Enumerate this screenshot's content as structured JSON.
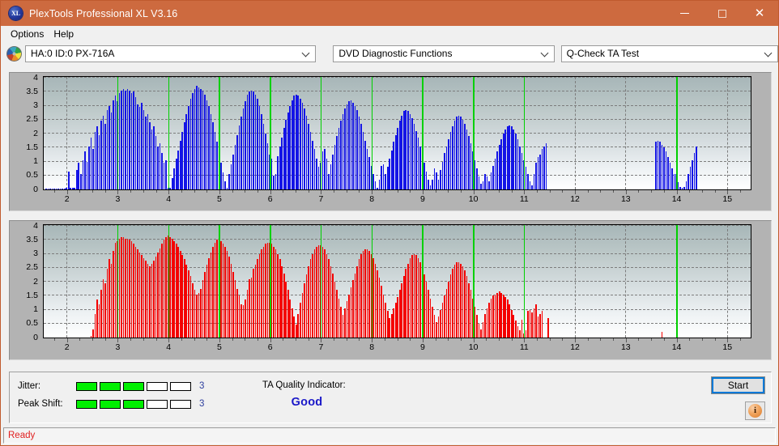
{
  "window": {
    "title": "PlexTools Professional XL V3.16",
    "icon": "xl-app-icon",
    "minimize_label": "–",
    "maximize_label": "□",
    "close_label": "×"
  },
  "menu": {
    "items": [
      {
        "label": "Options"
      },
      {
        "label": "Help"
      }
    ]
  },
  "toolbar": {
    "drive_icon": "disc-icon",
    "drive": "HA:0 ID:0  PX-716A",
    "function_group": "DVD Diagnostic Functions",
    "test": "Q-Check TA Test"
  },
  "info_panel": {
    "jitter_label": "Jitter:",
    "jitter_value": "3",
    "jitter_filled": 3,
    "jitter_total": 5,
    "peak_shift_label": "Peak Shift:",
    "peak_shift_value": "3",
    "peak_shift_filled": 3,
    "peak_shift_total": 5,
    "ta_quality_label": "TA Quality Indicator:",
    "ta_quality_value": "Good",
    "ta_quality_color": "#1a18c8",
    "start_label": "Start",
    "info_icon": "info-icon",
    "meter_on_color": "#00f000"
  },
  "status_bar": {
    "text": "Ready",
    "color": "#e02020"
  },
  "chart_data": [
    {
      "id": "jitter-chart",
      "type": "bar",
      "title": "",
      "xlabel": "",
      "ylabel": "",
      "series_name": "Jitter",
      "color": "#1414e6",
      "marker_color": "#00d000",
      "grid": true,
      "xlim": [
        1.55,
        15.45
      ],
      "ylim": [
        0,
        4
      ],
      "ytick_labels": [
        "4",
        "3.5",
        "3",
        "2.5",
        "2",
        "1.5",
        "1",
        "0.5",
        "0"
      ],
      "yticks": [
        4,
        3.5,
        3,
        2.5,
        2,
        1.5,
        1,
        0.5,
        0
      ],
      "xtick_labels": [
        "2",
        "3",
        "4",
        "5",
        "6",
        "7",
        "8",
        "9",
        "10",
        "11",
        "12",
        "13",
        "14",
        "15"
      ],
      "xticks": [
        2,
        3,
        4,
        5,
        6,
        7,
        8,
        9,
        10,
        11,
        12,
        13,
        14,
        15
      ],
      "markers": [
        3,
        4,
        5,
        6,
        7,
        8,
        9,
        10,
        11,
        14
      ],
      "x": [
        1.6,
        1.64,
        1.68,
        1.72,
        1.76,
        1.8,
        1.84,
        1.88,
        1.92,
        1.96,
        2.0,
        2.04,
        2.08,
        2.12,
        2.16,
        2.2,
        2.24,
        2.28,
        2.32,
        2.36,
        2.4,
        2.44,
        2.48,
        2.52,
        2.56,
        2.6,
        2.64,
        2.68,
        2.72,
        2.76,
        2.8,
        2.84,
        2.88,
        2.92,
        2.96,
        3.0,
        3.04,
        3.08,
        3.12,
        3.16,
        3.2,
        3.24,
        3.28,
        3.32,
        3.36,
        3.4,
        3.44,
        3.48,
        3.52,
        3.56,
        3.6,
        3.64,
        3.68,
        3.72,
        3.76,
        3.8,
        3.84,
        3.88,
        3.92,
        3.96,
        4.0,
        4.04,
        4.08,
        4.12,
        4.16,
        4.2,
        4.24,
        4.28,
        4.32,
        4.36,
        4.4,
        4.44,
        4.48,
        4.52,
        4.56,
        4.6,
        4.64,
        4.68,
        4.72,
        4.76,
        4.8,
        4.84,
        4.88,
        4.92,
        4.96,
        5.0,
        5.04,
        5.08,
        5.12,
        5.16,
        5.2,
        5.24,
        5.28,
        5.32,
        5.36,
        5.4,
        5.44,
        5.48,
        5.52,
        5.56,
        5.6,
        5.64,
        5.68,
        5.72,
        5.76,
        5.8,
        5.84,
        5.88,
        5.92,
        5.96,
        6.0,
        6.04,
        6.08,
        6.12,
        6.16,
        6.2,
        6.24,
        6.28,
        6.32,
        6.36,
        6.4,
        6.44,
        6.48,
        6.52,
        6.56,
        6.6,
        6.64,
        6.68,
        6.72,
        6.76,
        6.8,
        6.84,
        6.88,
        6.92,
        6.96,
        7.0,
        7.04,
        7.08,
        7.12,
        7.16,
        7.2,
        7.24,
        7.28,
        7.32,
        7.36,
        7.4,
        7.44,
        7.48,
        7.52,
        7.56,
        7.6,
        7.64,
        7.68,
        7.72,
        7.76,
        7.8,
        7.84,
        7.88,
        7.92,
        7.96,
        8.0,
        8.04,
        8.08,
        8.12,
        8.16,
        8.2,
        8.24,
        8.28,
        8.32,
        8.36,
        8.4,
        8.44,
        8.48,
        8.52,
        8.56,
        8.6,
        8.64,
        8.68,
        8.72,
        8.76,
        8.8,
        8.84,
        8.88,
        8.92,
        8.96,
        9.0,
        9.04,
        9.08,
        9.12,
        9.16,
        9.2,
        9.24,
        9.28,
        9.32,
        9.36,
        9.4,
        9.44,
        9.48,
        9.52,
        9.56,
        9.6,
        9.64,
        9.68,
        9.72,
        9.76,
        9.8,
        9.84,
        9.88,
        9.92,
        9.96,
        10.0,
        10.04,
        10.08,
        10.12,
        10.16,
        10.2,
        10.24,
        10.28,
        10.32,
        10.36,
        10.4,
        10.44,
        10.48,
        10.52,
        10.56,
        10.6,
        10.64,
        10.68,
        10.72,
        10.76,
        10.8,
        10.84,
        10.88,
        10.92,
        10.96,
        11.0,
        11.04,
        11.08,
        11.12,
        11.16,
        11.2,
        11.24,
        11.28,
        11.32,
        11.36,
        11.4,
        11.44,
        13.6,
        13.64,
        13.68,
        13.72,
        13.76,
        13.8,
        13.84,
        13.88,
        13.92,
        13.96,
        14.0,
        14.04,
        14.08,
        14.12,
        14.16,
        14.2,
        14.24,
        14.28,
        14.32,
        14.36,
        14.4
      ],
      "values": [
        0.04,
        0.04,
        0.04,
        0.04,
        0.04,
        0.04,
        0.04,
        0.04,
        0.04,
        0.04,
        0.05,
        0.65,
        0.05,
        0.05,
        0.05,
        0.7,
        0.95,
        0.55,
        1.05,
        1.35,
        1.0,
        1.55,
        1.85,
        1.45,
        2.05,
        2.25,
        1.95,
        2.45,
        2.65,
        2.35,
        2.85,
        3.0,
        2.75,
        3.2,
        3.35,
        3.15,
        3.45,
        3.55,
        3.6,
        3.55,
        3.6,
        3.55,
        3.45,
        3.5,
        3.3,
        3.05,
        2.95,
        3.1,
        2.85,
        2.6,
        2.7,
        2.4,
        2.15,
        2.25,
        1.9,
        1.55,
        1.65,
        1.3,
        0.95,
        1.05,
        0.05,
        0.05,
        0.4,
        0.75,
        1.1,
        1.4,
        1.75,
        2.05,
        2.4,
        2.7,
        3.0,
        3.25,
        3.45,
        3.6,
        3.7,
        3.65,
        3.6,
        3.55,
        3.4,
        3.2,
        3.0,
        2.7,
        2.4,
        2.05,
        1.7,
        1.3,
        0.95,
        0.6,
        0.3,
        0.05,
        0.55,
        0.9,
        1.25,
        1.6,
        1.95,
        2.3,
        2.6,
        2.9,
        3.15,
        3.4,
        3.5,
        3.55,
        3.5,
        3.4,
        3.25,
        3.0,
        2.7,
        2.35,
        2.0,
        1.65,
        1.25,
        1.1,
        0.5,
        0.55,
        1.2,
        1.55,
        1.85,
        2.2,
        2.5,
        2.75,
        3.0,
        3.2,
        3.35,
        3.4,
        3.35,
        3.25,
        3.1,
        2.9,
        2.65,
        2.35,
        2.05,
        1.75,
        1.45,
        1.1,
        0.8,
        0.95,
        1.35,
        1.45,
        1.1,
        0.55,
        0.9,
        1.25,
        1.6,
        1.9,
        2.2,
        2.45,
        2.7,
        2.9,
        3.05,
        3.15,
        3.2,
        3.1,
        3.0,
        2.85,
        2.6,
        2.35,
        2.05,
        1.75,
        1.45,
        1.15,
        0.85,
        0.55,
        0.3,
        0.05,
        0.35,
        0.85,
        0.9,
        0.55,
        0.8,
        1.1,
        1.4,
        1.7,
        1.95,
        2.2,
        2.45,
        2.65,
        2.8,
        2.85,
        2.8,
        2.7,
        2.55,
        2.35,
        2.1,
        1.85,
        1.55,
        1.25,
        0.95,
        0.65,
        0.35,
        0.15,
        0.35,
        0.75,
        0.6,
        0.35,
        0.7,
        1.0,
        1.3,
        1.55,
        1.8,
        2.05,
        2.25,
        2.45,
        2.6,
        2.65,
        2.6,
        2.5,
        2.35,
        2.15,
        1.9,
        1.65,
        1.35,
        1.05,
        0.75,
        0.45,
        0.2,
        0.3,
        0.55,
        0.45,
        0.3,
        0.6,
        0.85,
        1.1,
        1.35,
        1.6,
        1.8,
        2.0,
        2.15,
        2.25,
        2.3,
        2.25,
        2.15,
        2.0,
        1.8,
        1.55,
        1.3,
        1.05,
        0.8,
        0.55,
        0.3,
        0.15,
        0.55,
        0.95,
        1.15,
        1.25,
        1.45,
        1.55,
        1.65,
        1.7,
        1.75,
        1.7,
        1.6,
        1.5,
        1.35,
        1.15,
        0.95,
        0.75,
        0.55,
        0.55,
        0.25,
        0.1,
        0.05,
        0.1,
        0.3,
        0.55,
        0.8,
        1.05,
        1.3,
        1.55,
        1.75,
        1.95,
        2.1,
        2.15,
        2.2,
        2.15,
        2.05,
        1.9,
        1.7,
        1.45,
        1.15,
        0.85,
        0.5,
        0.2
      ]
    },
    {
      "id": "peak-shift-chart",
      "type": "bar",
      "title": "",
      "xlabel": "",
      "ylabel": "",
      "series_name": "Peak Shift",
      "color": "#f40000",
      "marker_color": "#00d000",
      "grid": true,
      "xlim": [
        1.55,
        15.45
      ],
      "ylim": [
        0,
        4
      ],
      "ytick_labels": [
        "4",
        "3.5",
        "3",
        "2.5",
        "2",
        "1.5",
        "1",
        "0.5",
        "0"
      ],
      "yticks": [
        4,
        3.5,
        3,
        2.5,
        2,
        1.5,
        1,
        0.5,
        0
      ],
      "xtick_labels": [
        "2",
        "3",
        "4",
        "5",
        "6",
        "7",
        "8",
        "9",
        "10",
        "11",
        "12",
        "13",
        "14",
        "15"
      ],
      "xticks": [
        2,
        3,
        4,
        5,
        6,
        7,
        8,
        9,
        10,
        11,
        12,
        13,
        14,
        15
      ],
      "markers": [
        3,
        4,
        5,
        6,
        7,
        8,
        9,
        10,
        11,
        14
      ],
      "x": [
        2.48,
        2.52,
        2.56,
        2.6,
        2.64,
        2.68,
        2.72,
        2.76,
        2.8,
        2.84,
        2.88,
        2.92,
        2.96,
        3.0,
        3.04,
        3.08,
        3.12,
        3.16,
        3.2,
        3.24,
        3.28,
        3.32,
        3.36,
        3.4,
        3.44,
        3.48,
        3.52,
        3.56,
        3.6,
        3.64,
        3.68,
        3.72,
        3.76,
        3.8,
        3.84,
        3.88,
        3.92,
        3.96,
        4.0,
        4.04,
        4.08,
        4.12,
        4.16,
        4.2,
        4.24,
        4.28,
        4.32,
        4.36,
        4.4,
        4.44,
        4.48,
        4.52,
        4.56,
        4.6,
        4.64,
        4.68,
        4.72,
        4.76,
        4.8,
        4.84,
        4.88,
        4.92,
        4.96,
        5.0,
        5.04,
        5.08,
        5.12,
        5.16,
        5.2,
        5.24,
        5.28,
        5.32,
        5.36,
        5.4,
        5.44,
        5.48,
        5.52,
        5.56,
        5.6,
        5.64,
        5.68,
        5.72,
        5.76,
        5.8,
        5.84,
        5.88,
        5.92,
        5.96,
        6.0,
        6.04,
        6.08,
        6.12,
        6.16,
        6.2,
        6.24,
        6.28,
        6.32,
        6.36,
        6.4,
        6.44,
        6.48,
        6.52,
        6.56,
        6.6,
        6.64,
        6.68,
        6.72,
        6.76,
        6.8,
        6.84,
        6.88,
        6.92,
        6.96,
        7.0,
        7.04,
        7.08,
        7.12,
        7.16,
        7.2,
        7.24,
        7.28,
        7.32,
        7.36,
        7.4,
        7.44,
        7.48,
        7.52,
        7.56,
        7.6,
        7.64,
        7.68,
        7.72,
        7.76,
        7.8,
        7.84,
        7.88,
        7.92,
        7.96,
        8.0,
        8.04,
        8.08,
        8.12,
        8.16,
        8.2,
        8.24,
        8.28,
        8.32,
        8.36,
        8.4,
        8.44,
        8.48,
        8.52,
        8.56,
        8.6,
        8.64,
        8.68,
        8.72,
        8.76,
        8.8,
        8.84,
        8.88,
        8.92,
        8.96,
        9.0,
        9.04,
        9.08,
        9.12,
        9.16,
        9.2,
        9.24,
        9.28,
        9.32,
        9.36,
        9.4,
        9.44,
        9.48,
        9.52,
        9.56,
        9.6,
        9.64,
        9.68,
        9.72,
        9.76,
        9.8,
        9.84,
        9.88,
        9.92,
        9.96,
        10.0,
        10.04,
        10.08,
        10.12,
        10.16,
        10.2,
        10.24,
        10.28,
        10.32,
        10.36,
        10.4,
        10.44,
        10.48,
        10.52,
        10.56,
        10.6,
        10.64,
        10.68,
        10.72,
        10.76,
        10.8,
        10.84,
        10.88,
        10.92,
        10.96,
        11.0,
        11.04,
        11.08,
        11.12,
        11.16,
        11.2,
        11.24,
        11.28,
        11.32,
        11.36,
        11.48,
        13.72,
        13.8,
        13.84,
        13.88,
        13.92,
        13.96,
        14.0,
        14.04,
        14.08,
        14.12,
        14.16
      ],
      "values": [
        0.05,
        0.3,
        0.85,
        1.35,
        1.2,
        1.7,
        2.1,
        1.95,
        2.45,
        2.8,
        2.65,
        3.1,
        3.4,
        3.45,
        3.55,
        3.6,
        3.6,
        3.55,
        3.55,
        3.5,
        3.45,
        3.35,
        3.25,
        3.15,
        3.05,
        2.95,
        2.85,
        2.75,
        2.65,
        2.55,
        2.65,
        2.75,
        2.9,
        3.05,
        3.2,
        3.35,
        3.5,
        3.6,
        3.65,
        3.6,
        3.55,
        3.45,
        3.35,
        3.25,
        3.1,
        2.95,
        2.8,
        2.6,
        2.4,
        2.2,
        1.95,
        1.7,
        1.55,
        1.6,
        1.75,
        2.05,
        2.35,
        2.6,
        2.85,
        3.05,
        3.25,
        3.4,
        3.5,
        3.5,
        3.45,
        3.35,
        3.25,
        3.1,
        2.9,
        2.65,
        2.35,
        2.05,
        1.75,
        1.5,
        1.2,
        1.15,
        1.35,
        1.7,
        2.1,
        2.15,
        2.45,
        2.6,
        2.8,
        3.0,
        3.15,
        3.25,
        3.35,
        3.4,
        3.4,
        3.35,
        3.25,
        3.15,
        3.0,
        2.8,
        2.55,
        2.3,
        2.0,
        1.7,
        1.35,
        1.05,
        0.75,
        0.45,
        0.85,
        1.25,
        1.6,
        1.95,
        2.25,
        2.55,
        2.8,
        3.0,
        3.15,
        3.25,
        3.3,
        3.3,
        3.25,
        3.15,
        3.0,
        2.8,
        2.55,
        2.3,
        2.0,
        1.7,
        1.4,
        1.1,
        0.8,
        1.05,
        1.3,
        1.55,
        1.8,
        2.05,
        2.3,
        2.55,
        2.8,
        3.0,
        3.1,
        3.15,
        3.15,
        3.1,
        3.0,
        2.85,
        2.65,
        2.4,
        2.15,
        1.85,
        1.55,
        1.25,
        0.95,
        0.7,
        0.85,
        1.05,
        1.25,
        1.45,
        1.7,
        1.95,
        2.2,
        2.45,
        2.65,
        2.85,
        2.95,
        3.0,
        2.95,
        2.85,
        2.7,
        2.5,
        2.25,
        2.0,
        1.7,
        1.4,
        1.1,
        0.8,
        0.55,
        0.75,
        1.0,
        1.25,
        1.5,
        1.75,
        2.0,
        2.25,
        2.45,
        2.6,
        2.7,
        2.7,
        2.65,
        2.55,
        2.4,
        2.2,
        1.95,
        1.7,
        1.4,
        1.1,
        0.8,
        0.5,
        0.3,
        0.55,
        0.85,
        1.05,
        1.25,
        1.4,
        1.5,
        1.55,
        1.6,
        1.65,
        1.6,
        1.55,
        1.45,
        1.35,
        1.2,
        1.0,
        0.8,
        0.6,
        0.4,
        0.25,
        0.65,
        0.15,
        0.25,
        0.95,
        1.0,
        0.9,
        1.05,
        1.2,
        0.75,
        0.85,
        0.95,
        0.7,
        0.2
      ]
    }
  ]
}
